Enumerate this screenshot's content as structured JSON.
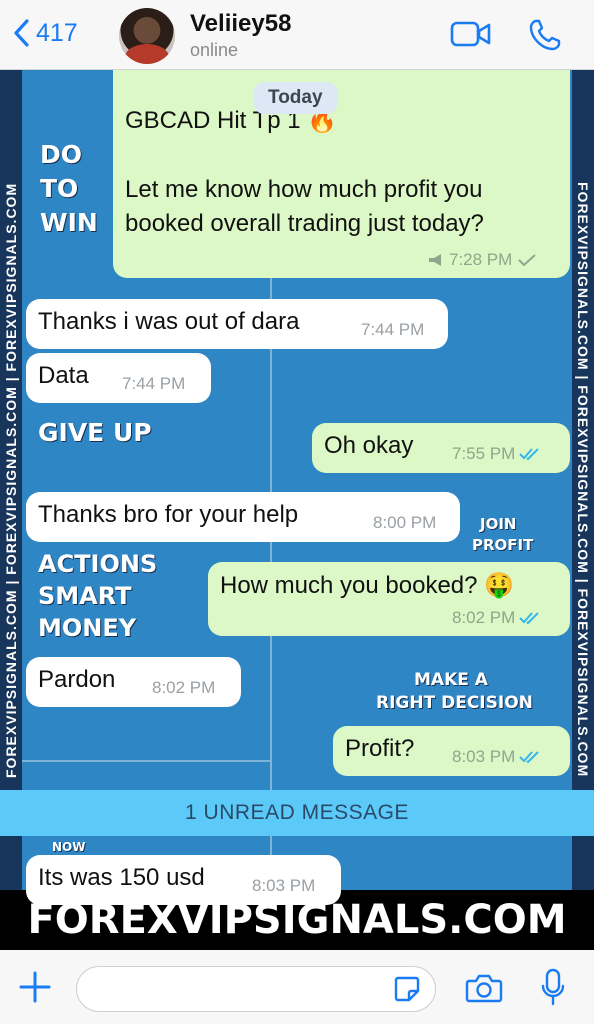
{
  "header": {
    "back_count": "417",
    "contact_name": "Veliiey58",
    "contact_status": "online",
    "icons": [
      "chevron-left-icon",
      "video-call-icon",
      "phone-icon"
    ],
    "accent_color": "#1a7cf2"
  },
  "chat": {
    "date_chip": "Today",
    "messages": [
      {
        "direction": "out",
        "text": "GBCAD Hit Tp 1 🔥",
        "text2": "Let me know how much profit you",
        "text3": "booked overall trading just today?",
        "time": "7:28 PM",
        "status": "sent"
      },
      {
        "direction": "in",
        "text": "Thanks i was out of dara",
        "time": "7:44 PM"
      },
      {
        "direction": "in",
        "text": "Data",
        "time": "7:44 PM"
      },
      {
        "direction": "out",
        "text": "Oh okay",
        "time": "7:55 PM",
        "status": "read"
      },
      {
        "direction": "in",
        "text": "Thanks bro for your help",
        "time": "8:00 PM"
      },
      {
        "direction": "out",
        "text": "How much you booked? 🤑",
        "time": "8:02 PM",
        "status": "read"
      },
      {
        "direction": "in",
        "text": "Pardon",
        "time": "8:02 PM"
      },
      {
        "direction": "out",
        "text": "Profit?",
        "time": "8:03 PM",
        "status": "read"
      },
      {
        "direction": "in",
        "text": "Its was 150 usd",
        "time": "8:03 PM"
      }
    ],
    "unread_banner": "1 UNREAD MESSAGE"
  },
  "wallpaper": {
    "side_text": "FOREXVIPSIGNALS.COM | FOREXVIPSIGNALS.COM | FOREXVIPSIGNALS.COM",
    "poster_lines": [
      "DO",
      "TO",
      "WIN",
      "GIVE UP",
      "ACTIONS",
      "SMART",
      "MONEY",
      "JOIN",
      "PROFIT",
      "MAKE A",
      "RIGHT DECISION",
      "NOW"
    ],
    "footer": "FOREXVIPSIGNALS.COM"
  },
  "input": {
    "placeholder": "",
    "icons": [
      "plus-icon",
      "sticker-icon",
      "camera-icon",
      "microphone-icon"
    ]
  }
}
